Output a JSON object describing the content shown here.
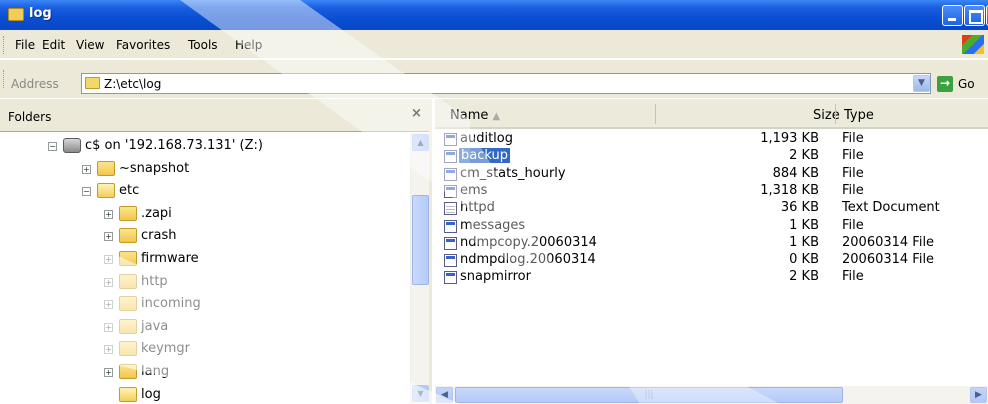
{
  "window": {
    "title": "log"
  },
  "menu": [
    "File",
    "Edit",
    "View",
    "Favorites",
    "Tools",
    "Help"
  ],
  "address": {
    "label": "Address",
    "value": "Z:\\etc\\log",
    "go_label": "Go"
  },
  "folders_pane": {
    "title": "Folders",
    "close_glyph": "×",
    "tree": [
      {
        "label": "c$ on '192.168.73.131' (Z:)",
        "level": 0,
        "icon": "network-drive-icon",
        "expanded": true
      },
      {
        "label": "~snapshot",
        "level": 1,
        "icon": "folder-icon",
        "expanded": false
      },
      {
        "label": "etc",
        "level": 1,
        "icon": "folder-open-icon",
        "expanded": true
      },
      {
        "label": ".zapi",
        "level": 2,
        "icon": "folder-icon",
        "expanded": false
      },
      {
        "label": "crash",
        "level": 2,
        "icon": "folder-icon",
        "expanded": false
      },
      {
        "label": "firmware",
        "level": 2,
        "icon": "folder-icon",
        "expanded": false
      },
      {
        "label": "http",
        "level": 2,
        "icon": "folder-icon",
        "expanded": false
      },
      {
        "label": "incoming",
        "level": 2,
        "icon": "folder-icon",
        "expanded": false
      },
      {
        "label": "java",
        "level": 2,
        "icon": "folder-icon",
        "expanded": false
      },
      {
        "label": "keymgr",
        "level": 2,
        "icon": "folder-icon",
        "expanded": false
      },
      {
        "label": "lang",
        "level": 2,
        "icon": "folder-icon",
        "expanded": false
      },
      {
        "label": "log",
        "level": 2,
        "icon": "folder-open-icon",
        "expanded": null
      }
    ]
  },
  "file_list": {
    "columns": {
      "name": "Name",
      "size": "Size",
      "type": "Type"
    },
    "sort_indicator": "▲",
    "selected": "backup",
    "files": [
      {
        "name": "auditlog",
        "size": "1,193 KB",
        "type": "File",
        "icon": "file-icon"
      },
      {
        "name": "backup",
        "size": "2 KB",
        "type": "File",
        "icon": "file-icon"
      },
      {
        "name": "cm_stats_hourly",
        "size": "884 KB",
        "type": "File",
        "icon": "file-icon"
      },
      {
        "name": "ems",
        "size": "1,318 KB",
        "type": "File",
        "icon": "file-icon"
      },
      {
        "name": "httpd",
        "size": "36 KB",
        "type": "Text Document",
        "icon": "text-document-icon"
      },
      {
        "name": "messages",
        "size": "1 KB",
        "type": "File",
        "icon": "file-icon"
      },
      {
        "name": "ndmpcopy.20060314",
        "size": "1 KB",
        "type": "20060314 File",
        "icon": "file-icon"
      },
      {
        "name": "ndmpdlog.20060314",
        "size": "0 KB",
        "type": "20060314 File",
        "icon": "file-icon"
      },
      {
        "name": "snapmirror",
        "size": "2 KB",
        "type": "File",
        "icon": "file-icon"
      }
    ]
  },
  "colors": {
    "title_bar": "#0a4fd2",
    "selection": "#316ac5",
    "chrome": "#ece9d8"
  }
}
